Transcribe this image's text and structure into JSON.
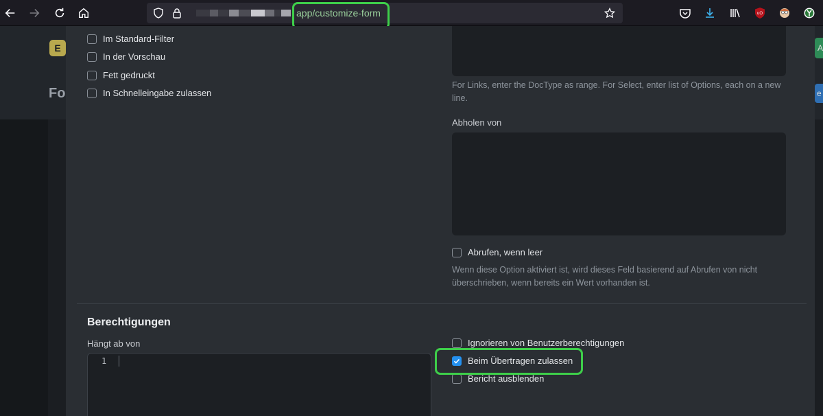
{
  "browser": {
    "url_text": "app/customize-form",
    "url_blur_colors": [
      "#3a3a42",
      "#5b5b63",
      "#3a3a42",
      "#8b8b92",
      "#4c4c54",
      "#c9c9cf",
      "#6e6e76",
      "#3a3a42",
      "#a6a6ad"
    ]
  },
  "background_page": {
    "logo_letter": "E",
    "title_fragment": "For",
    "right_tab_top": "A",
    "right_tab_bottom": "e"
  },
  "left_checkboxes": [
    {
      "label": "Im Standard-Filter",
      "checked": false
    },
    {
      "label": "In der Vorschau",
      "checked": false
    },
    {
      "label": "Fett gedruckt",
      "checked": false
    },
    {
      "label": "In Schnelleingabe zulassen",
      "checked": false
    }
  ],
  "options_help": "For Links, enter the DocType as range. For Select, enter list of Options, each on a new line.",
  "fetch_from_label": "Abholen von",
  "fetch_if_empty": {
    "label": "Abrufen, wenn leer",
    "checked": false
  },
  "fetch_if_empty_help": "Wenn diese Option aktiviert ist, wird dieses Feld basierend auf Abrufen von nicht überschrieben, wenn bereits ein Wert vorhanden ist.",
  "permissions": {
    "title": "Berechtigungen",
    "depends_on_label": "Hängt ab von",
    "editor_line_number": "1",
    "checkboxes": [
      {
        "label": "Ignorieren von Benutzerberechtigungen",
        "checked": false
      },
      {
        "label": "Beim Übertragen zulassen",
        "checked": true
      },
      {
        "label": "Bericht ausblenden",
        "checked": false
      }
    ]
  },
  "colors": {
    "highlight": "#3ecf4a",
    "checkbox_checked": "#2490ef",
    "modal_bg": "#2a2e33"
  }
}
